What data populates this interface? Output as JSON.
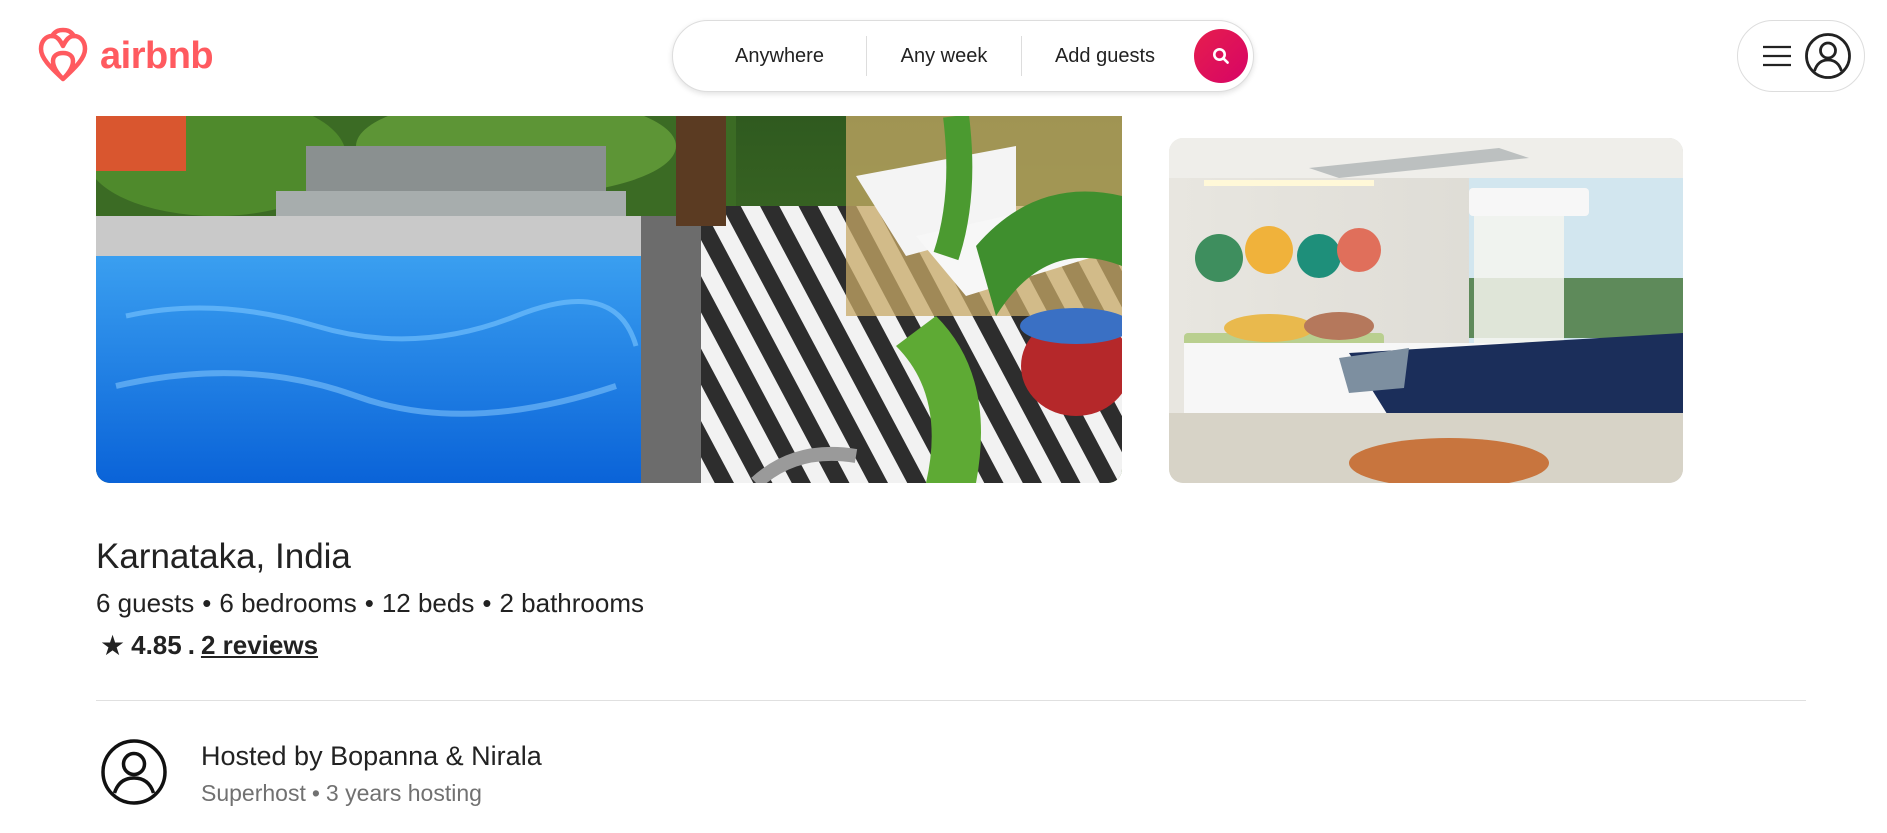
{
  "header": {
    "logo_text": "airbnb",
    "search": {
      "location": "Anywhere",
      "dates": "Any week",
      "guests": "Add guests"
    }
  },
  "listing": {
    "title": "Karnataka, India",
    "specs": [
      "6 guests",
      "6 bedrooms",
      "12 beds",
      "2 bathrooms"
    ],
    "separator": "•",
    "rating": {
      "star": "★",
      "score": "4.85",
      "dot": ".",
      "reviews_link": "2 reviews"
    },
    "host": {
      "name": "Hosted by Bopanna & Nirala",
      "badge": "Superhost",
      "tenure": "3 years hosting"
    }
  },
  "icons": {
    "logo": "airbnb-logo-icon",
    "search": "search-icon",
    "menu": "hamburger-menu-icon",
    "profile": "user-profile-icon",
    "host": "host-avatar-icon",
    "star": "star-icon"
  },
  "colors": {
    "brand": "#ff5a5f",
    "search_button": "#e61e4d",
    "text_primary": "#222222",
    "text_secondary": "#717171"
  }
}
